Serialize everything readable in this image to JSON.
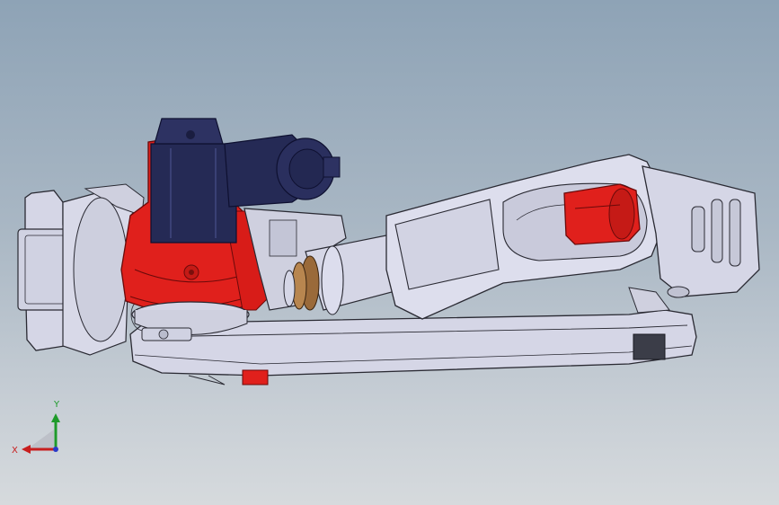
{
  "viewport": {
    "background_top": "#8ea3b6",
    "background_bottom": "#d6dadd"
  },
  "model": {
    "body_color": "#d5d6e6",
    "edge_color": "#2a2a33",
    "accent_color": "#e0201c",
    "motor_color": "#252a55",
    "bronze_color": "#9a6a3a"
  },
  "triad": {
    "x_label": "X",
    "y_label": "Y",
    "x_color": "#c81e1e",
    "y_color": "#1e9a2a",
    "z_color": "#2a3ac8"
  }
}
